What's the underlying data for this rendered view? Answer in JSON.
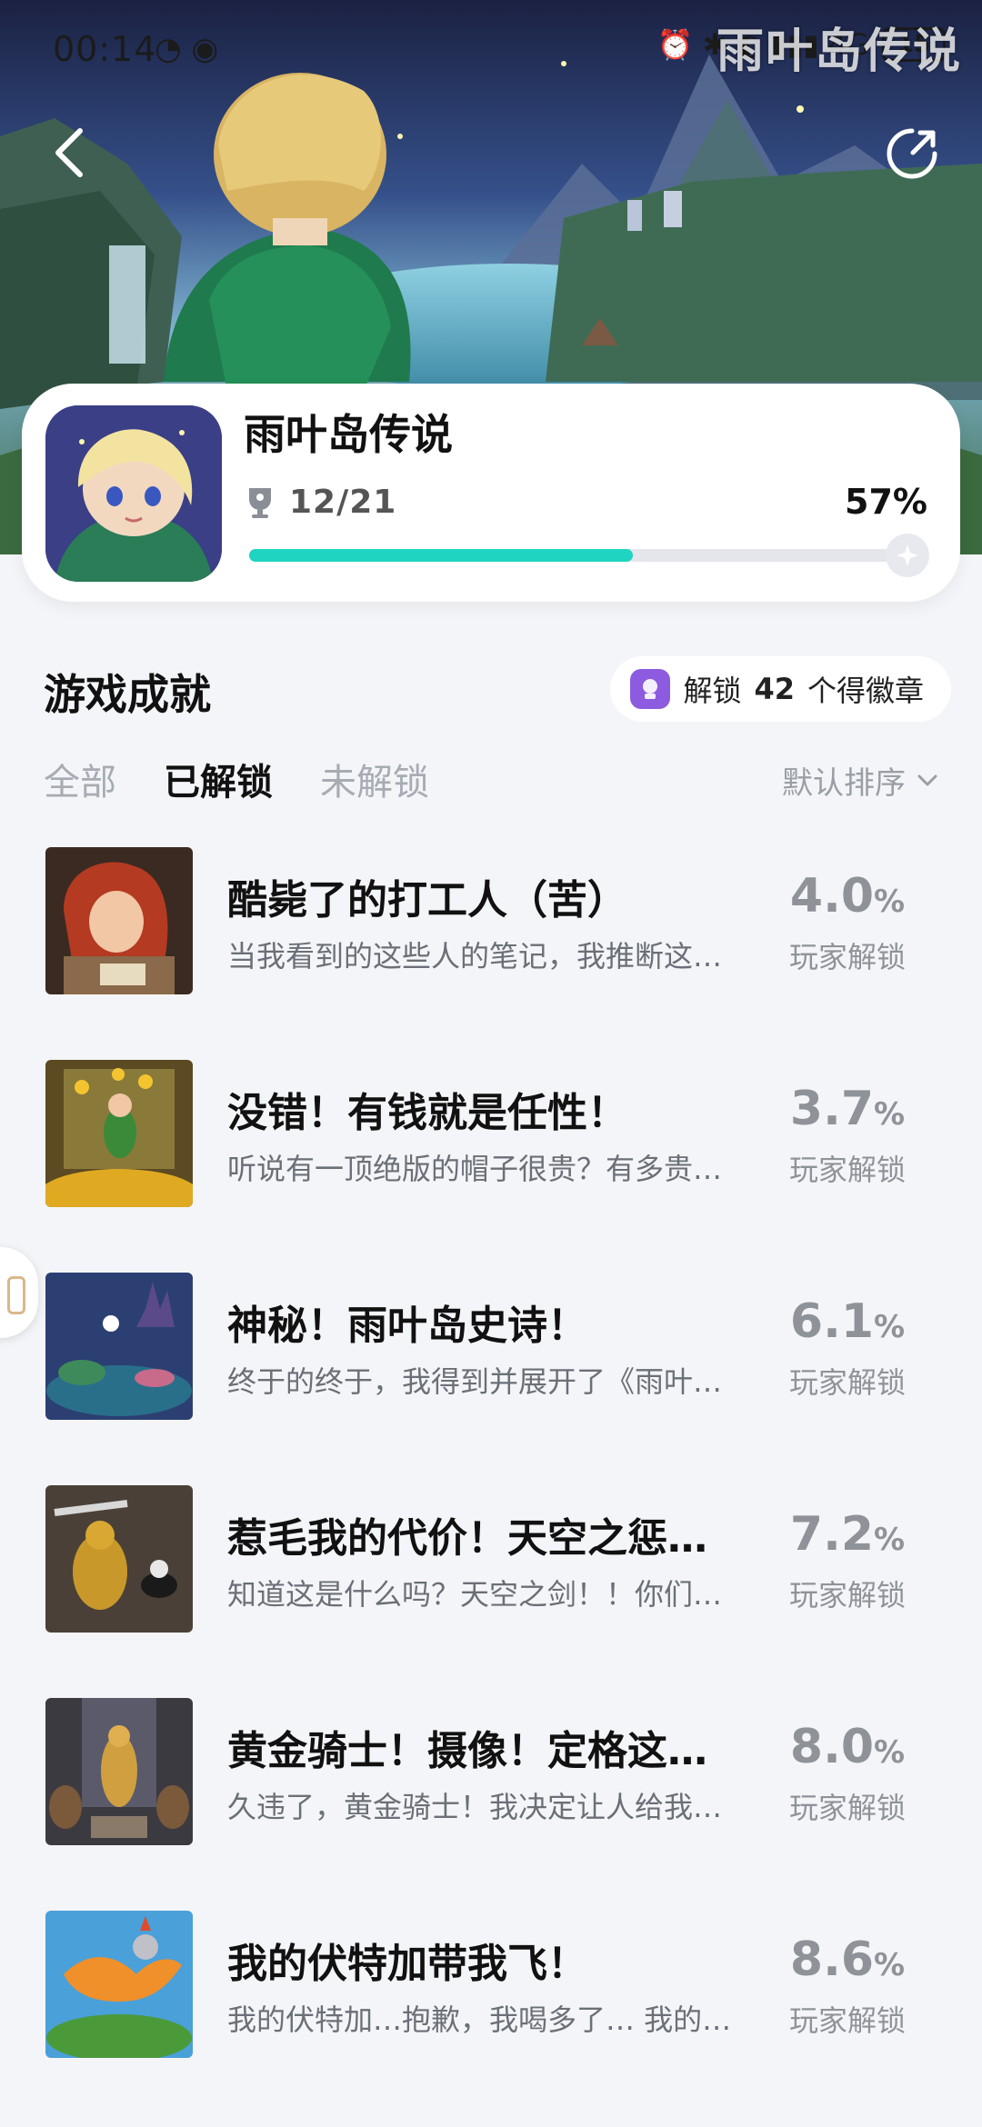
{
  "status_bar": {
    "time": "00:14",
    "left_icons": "◔ ◉",
    "right_icons": "⏰ ✱ ◐ ▮▮▮ 4G",
    "battery": "15"
  },
  "watermark": "雨叶岛传说",
  "header": {
    "back_icon": "chevron-left-icon",
    "share_icon": "share-icon"
  },
  "game": {
    "title": "雨叶岛传说",
    "achievements_unlocked": "12/21",
    "progress_percent_text": "57%",
    "progress_fraction": 0.57
  },
  "section": {
    "title": "游戏成就",
    "badge_prefix": "解锁",
    "badge_count": "42",
    "badge_suffix": "个得徽章"
  },
  "tabs": [
    {
      "label": "全部",
      "active": false
    },
    {
      "label": "已解锁",
      "active": true
    },
    {
      "label": "未解锁",
      "active": false
    }
  ],
  "sort_label": "默认排序",
  "rate_label": "玩家解锁",
  "rate_suffix": "%",
  "achievements": [
    {
      "title": "酷毙了的打工人（苦）",
      "desc": "当我看到的这些人的笔记，我推断这…",
      "rate": "4.0"
    },
    {
      "title": "没错！有钱就是任性！",
      "desc": "听说有一顶绝版的帽子很贵？有多贵…",
      "rate": "3.7"
    },
    {
      "title": "神秘！雨叶岛史诗！",
      "desc": "终于的终于，我得到并展开了《雨叶…",
      "rate": "6.1"
    },
    {
      "title": "惹毛我的代价！天空之惩…",
      "desc": "知道这是什么吗？天空之剑！！你们…",
      "rate": "7.2"
    },
    {
      "title": "黄金骑士！摄像！定格这…",
      "desc": "久违了，黄金骑士！我决定让人给我…",
      "rate": "8.0"
    },
    {
      "title": "我的伏特加带我飞！",
      "desc": "我的伏特加…抱歉，我喝多了… 我的…",
      "rate": "8.6"
    }
  ],
  "colors": {
    "accent": "#1fd4c0",
    "badge": "#8c5be0",
    "background": "#f4f5f8"
  }
}
